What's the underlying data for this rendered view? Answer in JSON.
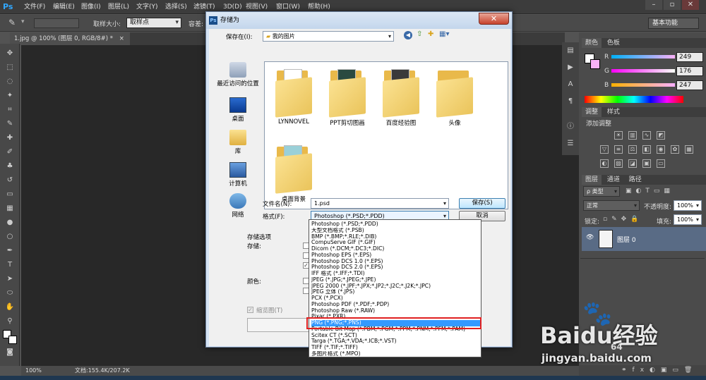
{
  "app": {
    "logo": "Ps"
  },
  "menu": [
    "文件(F)",
    "编辑(E)",
    "图像(I)",
    "图层(L)",
    "文字(Y)",
    "选择(S)",
    "滤镜(T)",
    "3D(D)",
    "视图(V)",
    "窗口(W)",
    "帮助(H)"
  ],
  "window_controls": {
    "minimize": "–",
    "restore": "▫",
    "close": "✕"
  },
  "options": {
    "sample_size_label": "取样大小:",
    "sample_size_value": "取样点",
    "tolerance_label": "容差:",
    "workspace": "基本功能"
  },
  "document": {
    "tab_label": "1.jpg @ 100% (图层 0, RGB/8#) *",
    "tab_close": "×",
    "zoom": "100%",
    "doc_info": "文档:155.4K/207.2K"
  },
  "panels": {
    "color_tabs": [
      "颜色",
      "色板"
    ],
    "r_label": "R",
    "r_value": "249",
    "g_label": "G",
    "g_value": "176",
    "b_label": "B",
    "b_value": "247",
    "adjust_tabs": [
      "调整",
      "样式"
    ],
    "adjust_title": "添加调整",
    "layers_tabs": [
      "图层",
      "通道",
      "路径"
    ],
    "kind_label": "ρ 类型",
    "blend_mode": "正常",
    "opacity_label": "不透明度:",
    "opacity_value": "100%",
    "lock_label": "锁定:",
    "fill_label": "填充:",
    "fill_value": "100%",
    "layer_name": "图层 0"
  },
  "dialog": {
    "title": "存储为",
    "close": "✕",
    "save_in_label": "保存在(I):",
    "save_in_value": "我的图片",
    "places": [
      "最近访问的位置",
      "桌面",
      "库",
      "计算机",
      "网络"
    ],
    "folders": [
      "LYNNOVEL",
      "PPT剪切图画",
      "百度经验图",
      "头像",
      "桌面背景"
    ],
    "filename_label": "文件名(N):",
    "filename_value": "1.psd",
    "format_label": "格式(F):",
    "format_value": "Photoshop (*.PSD;*.PDD)",
    "save_button": "保存(S)",
    "cancel_button": "取消",
    "storage_options_label": "存储选项",
    "storage_label": "存储:",
    "color_label": "颜色:",
    "thumbnail_label": "缩览图(T)"
  },
  "format_options": [
    "Photoshop (*.PSD;*.PDD)",
    "大型文档格式 (*.PSB)",
    "BMP (*.BMP;*.RLE;*.DIB)",
    "CompuServe GIF (*.GIF)",
    "Dicom (*.DCM;*.DC3;*.DIC)",
    "Photoshop EPS (*.EPS)",
    "Photoshop DCS 1.0 (*.EPS)",
    "Photoshop DCS 2.0 (*.EPS)",
    "IFF 格式 (*.IFF;*.TDI)",
    "JPEG (*.JPG;*.JPEG;*.JPE)",
    "JPEG 2000 (*.JPF;*.JPX;*.JP2;*.J2C;*.J2K;*.JPC)",
    "JPEG 立体 (*.JPS)",
    "PCX (*.PCX)",
    "Photoshop PDF (*.PDF;*.PDP)",
    "Photoshop Raw (*.RAW)",
    "Pixar (*.PXR)",
    "PNG (*.PNG;*.PNS)",
    "Portable Bit Map (*.PBM;*.PGM;*.PPM;*.PNM;*.PFM;*.PAM)",
    "Scitex CT (*.SCT)",
    "Targa (*.TGA;*.VDA;*.ICB;*.VST)",
    "TIFF (*.TIF;*.TIFF)",
    "多图片格式 (*.MPO)"
  ],
  "selected_format_index": 16,
  "colors": {
    "highlight": "#e02020",
    "selection": "#3399ff",
    "accent": "#31a8ff"
  },
  "watermark": {
    "brand": "Baidu经验",
    "url": "jingyan.baidu.com",
    "corner": "64"
  }
}
